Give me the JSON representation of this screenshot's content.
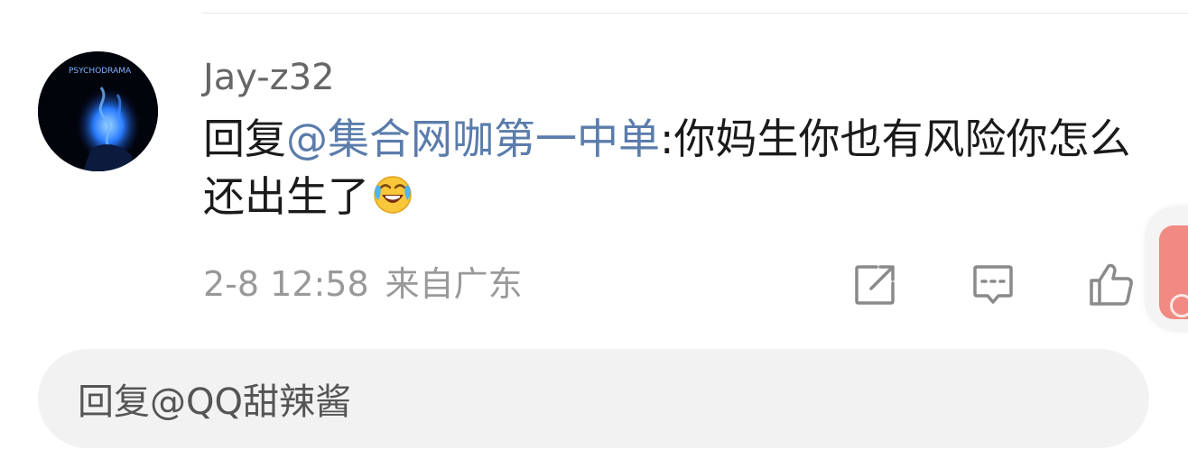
{
  "comment": {
    "username": "Jay-z32",
    "avatar_text": "PSYCHODRAMA",
    "reply_prefix": "回复",
    "mention": "@集合网咖第一中单",
    "text": ":你妈生你也有风险你怎么还出生了",
    "emoji": "laughing-crying-emoji",
    "time": "2-8 12:58",
    "location": "来自广东"
  },
  "actions": {
    "share_icon": "share-icon",
    "comment_icon": "comment-icon",
    "like_icon": "like-icon"
  },
  "reply_input": {
    "placeholder": "回复@QQ甜辣酱"
  },
  "colors": {
    "mention": "#5a7cab",
    "meta": "#999999",
    "username": "#666666"
  }
}
